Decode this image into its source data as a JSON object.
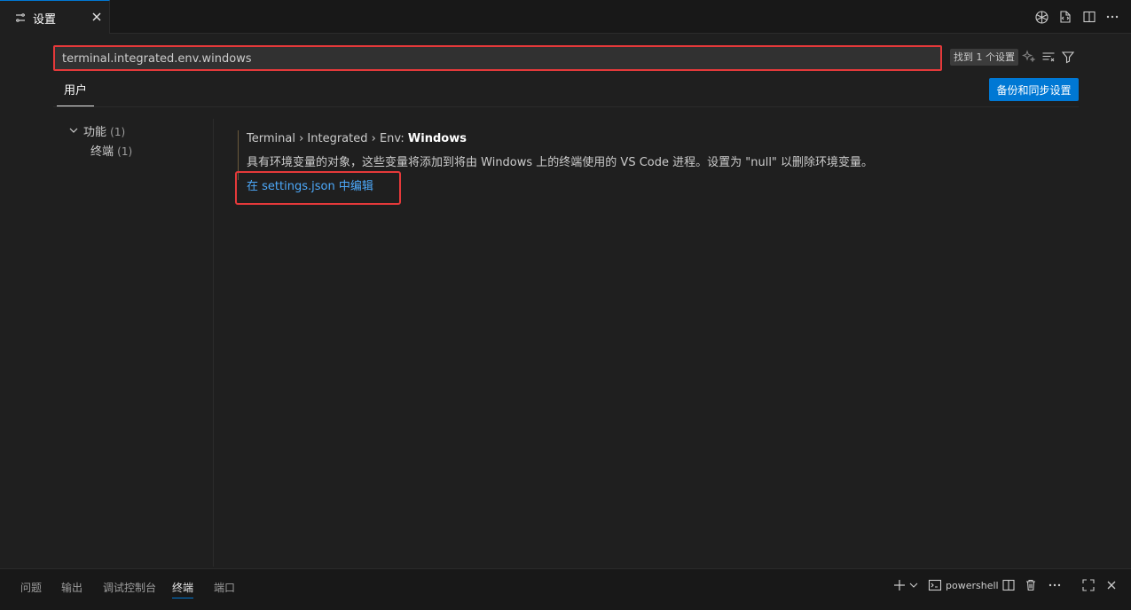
{
  "editor_tab": {
    "label": "设置",
    "icon": "settings-sliders-icon",
    "close_icon": "close-icon"
  },
  "editor_actions": [
    "copilot-icon",
    "open-settings-json-icon",
    "split-editor-icon",
    "more-actions-icon"
  ],
  "search": {
    "value": "terminal.integrated.env.windows",
    "result_badge": "找到 1 个设置",
    "buttons": [
      "ai-sparkle-icon",
      "clear-filter-icon",
      "filter-icon"
    ]
  },
  "scope_tab": "用户",
  "backup_button": "备份和同步设置",
  "toc": {
    "group_label": "功能",
    "group_count": "(1)",
    "item_label": "终端",
    "item_count": "(1)"
  },
  "setting": {
    "breadcrumb": "Terminal › Integrated › Env: ",
    "name": "Windows",
    "description": "具有环境变量的对象，这些变量将添加到将由 Windows 上的终端使用的 VS Code 进程。设置为 \"null\" 以删除环境变量。",
    "edit_link": "在 settings.json 中编辑"
  },
  "panel": {
    "tabs": [
      "问题",
      "输出",
      "调试控制台",
      "终端",
      "端口"
    ],
    "active_tab": "终端",
    "terminal_name": "powershell"
  },
  "colors": {
    "accent": "#0078d4",
    "highlight_box": "#e5393a",
    "link": "#4daafc",
    "background": "#1f1f1f"
  }
}
